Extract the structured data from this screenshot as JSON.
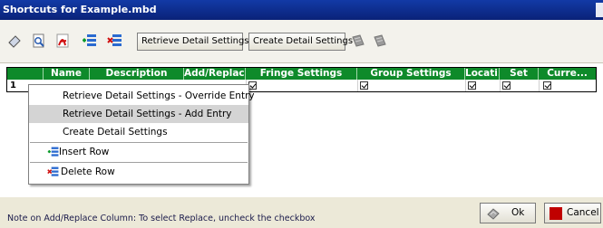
{
  "window": {
    "title": "Shortcuts for Example.mbd"
  },
  "toolbar": {
    "icons": [
      "eraser-icon",
      "search-doc-icon",
      "pdf-icon",
      "insert-row-icon",
      "delete-row-icon",
      "grey-doc-icon",
      "grey-doc-icon"
    ],
    "retrieve_label": "Retrieve Detail Settings",
    "create_label": "Create Detail Settings"
  },
  "grid": {
    "columns": [
      "",
      "Name",
      "Description",
      "Add/Replace",
      "Fringe Settings",
      "Group Settings",
      "Locati...",
      "Set",
      "Curre..."
    ],
    "rows": [
      {
        "num": "1",
        "add_replace": true,
        "fringe": true,
        "group": true,
        "location": true,
        "set": true,
        "currency": true
      }
    ]
  },
  "context_menu": {
    "items": [
      {
        "label": "Retrieve Detail Settings - Override Entry",
        "highlighted": false
      },
      {
        "label": "Retrieve Detail Settings - Add Entry",
        "highlighted": true
      },
      {
        "label": "Create Detail Settings",
        "highlighted": false
      },
      {
        "label": "Insert Row",
        "icon": "insert-row-icon"
      },
      {
        "label": "Delete Row",
        "icon": "delete-row-icon"
      }
    ]
  },
  "status": {
    "note": "Note on Add/Replace Column: To select Replace, uncheck the checkbox",
    "ok_label": "Ok",
    "cancel_label": "Cancel"
  },
  "colors": {
    "title_bar": "#0b2a8e",
    "grid_header": "#0e8a2a",
    "highlight": "#d4d4d4",
    "cancel_icon": "#c00000"
  }
}
